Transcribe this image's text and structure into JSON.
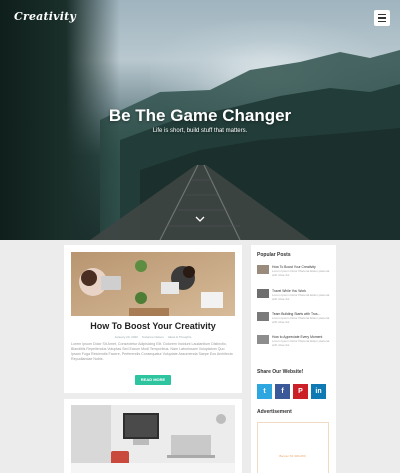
{
  "site": {
    "logo": "Creativity"
  },
  "hero": {
    "title": "Be The Game Changer",
    "subtitle": "Life is short, build stuff that matters."
  },
  "post": {
    "title": "How To Boost Your Creativity",
    "meta": [
      "January 20, 2020",
      "Suzanne Nelson",
      "Ideas & Thoughts"
    ],
    "excerpt": "Lorem Ipsum Dolor Sit Amet, Consectetur Adipisicing Elit. Dolorem Incidunt Laudantium Distinctio, Blanditiis Repellendus Voluptas Sed Earum Modi Temporibus. Nam Laboriosam Voluptatum Quo Ipsam Fuga Reiciendis Facere, Perferendis Consequatur Voluptate Assumenda Saepe Eos Architecto Repudiandae Nobis.",
    "read_more": "READ MORE"
  },
  "sidebar": {
    "popular_heading": "Popular Posts",
    "popular": [
      {
        "title": "How To Boost Your Creativity",
        "excerpt": "Lorem Ipsum Dolor Placerat Etiam placerat with vitae dui"
      },
      {
        "title": "Travel While You Work",
        "excerpt": "Lorem Ipsum Dolor Placerat Etiam placerat with vitae dui"
      },
      {
        "title": "Team Building Starts with Trus...",
        "excerpt": "Lorem Ipsum Dolor Placerat Etiam placerat with vitae dui"
      },
      {
        "title": "How to Appreciate Every Moment",
        "excerpt": "Lorem Ipsum Dolor Placerat Etiam placerat with vitae dui"
      }
    ],
    "share_heading": "Share Our Website!",
    "share": [
      {
        "icon": "twitter-icon",
        "glyph": "t",
        "color": "#2ea7e0"
      },
      {
        "icon": "facebook-icon",
        "glyph": "f",
        "color": "#3b5998"
      },
      {
        "icon": "pinterest-icon",
        "glyph": "P",
        "color": "#cb2027"
      },
      {
        "icon": "linkedin-icon",
        "glyph": "in",
        "color": "#0f79b3"
      }
    ],
    "ad_heading": "Advertisement",
    "ad_label": "Banner 60 300x250"
  },
  "colors": {
    "accent": "#2ec4a0",
    "background": "#ececec"
  }
}
